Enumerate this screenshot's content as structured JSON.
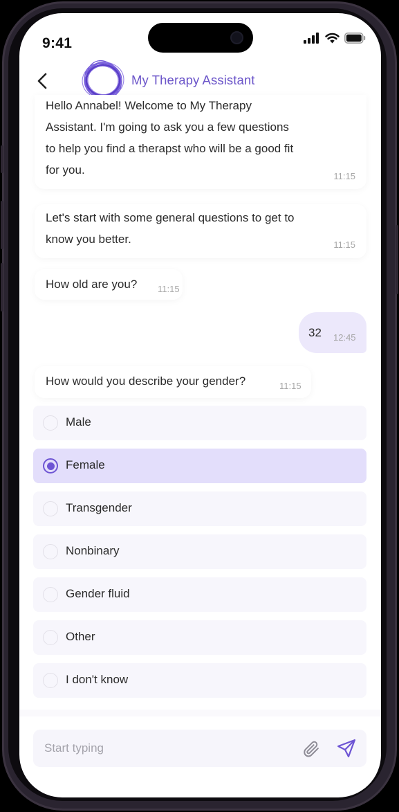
{
  "status_bar": {
    "time": "9:41"
  },
  "header": {
    "title": "My Therapy Assistant"
  },
  "messages": [
    {
      "text": "Hello Annabel! Welcome to My Therapy Assistant. I'm going to ask you a few questions to help you find a therapst who will be a good fit for you.",
      "lines": [
        "Hello Annabel! Welcome to My Therapy",
        "Assistant. I'm going to ask you a few questions",
        "to help you find a therapst who will be a good fit",
        "for you."
      ],
      "time": "11:15"
    },
    {
      "text": "Let's start with some general questions to get to know you better.",
      "lines": [
        "Let's start with some general questions to get to",
        "know you better."
      ],
      "time": "11:15"
    },
    {
      "text": "How old are you?",
      "time": "11:15"
    },
    {
      "text": "32",
      "time": "12:45",
      "from_user": true
    },
    {
      "text": "How would you describe your gender?",
      "time": "11:15"
    }
  ],
  "gender_options": [
    {
      "label": "Male",
      "selected": false
    },
    {
      "label": "Female",
      "selected": true
    },
    {
      "label": "Transgender",
      "selected": false
    },
    {
      "label": "Nonbinary",
      "selected": false
    },
    {
      "label": "Gender fluid",
      "selected": false
    },
    {
      "label": "Other",
      "selected": false
    },
    {
      "label": "I don't know",
      "selected": false
    }
  ],
  "composer": {
    "placeholder": "Start typing"
  },
  "colors": {
    "accent": "#6e55d4",
    "title": "#6b55c9",
    "selected_option_bg": "#e3defb",
    "user_bubble_bg": "#ece8fb",
    "option_bg": "#f7f6fc"
  },
  "icons": {
    "back": "chevron-left-icon",
    "avatar": "scribble-ring-logo",
    "attach": "paperclip-icon",
    "send": "send-plane-icon",
    "signal": "cellular-signal-icon",
    "wifi": "wifi-icon",
    "battery": "battery-icon"
  }
}
